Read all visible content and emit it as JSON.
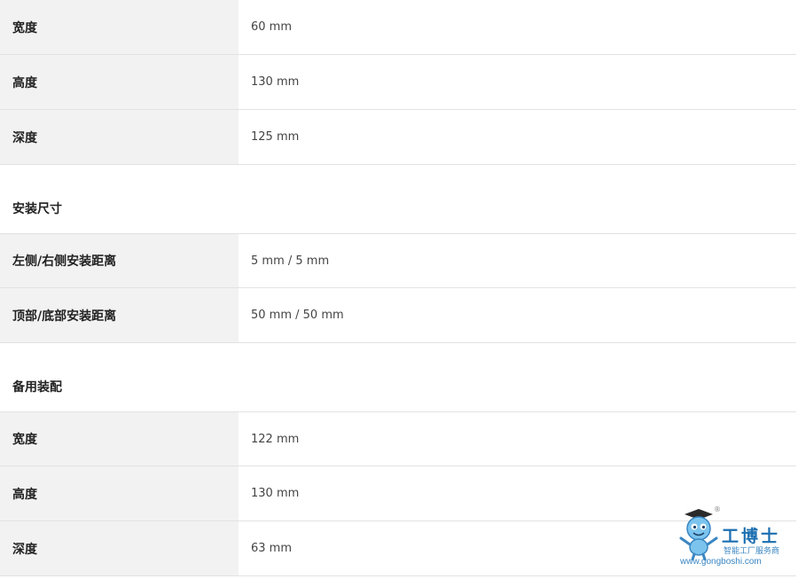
{
  "group1": {
    "rows": [
      {
        "label": "宽度",
        "value": "60 mm"
      },
      {
        "label": "高度",
        "value": "130 mm"
      },
      {
        "label": "深度",
        "value": "125 mm"
      }
    ]
  },
  "group2": {
    "title": "安装尺寸",
    "rows": [
      {
        "label": "左侧/右侧安装距离",
        "value": "5 mm / 5 mm"
      },
      {
        "label": "顶部/底部安装距离",
        "value": "50 mm / 50 mm"
      }
    ]
  },
  "group3": {
    "title": "备用装配",
    "rows": [
      {
        "label": "宽度",
        "value": "122 mm"
      },
      {
        "label": "高度",
        "value": "130 mm"
      },
      {
        "label": "深度",
        "value": "63 mm"
      }
    ]
  },
  "watermark": {
    "brand": "工博士",
    "subtitle": "智能工厂服务商",
    "url": "www.gongboshi.com",
    "registered": "®",
    "mascot_icon": "robot-mascot-icon"
  }
}
